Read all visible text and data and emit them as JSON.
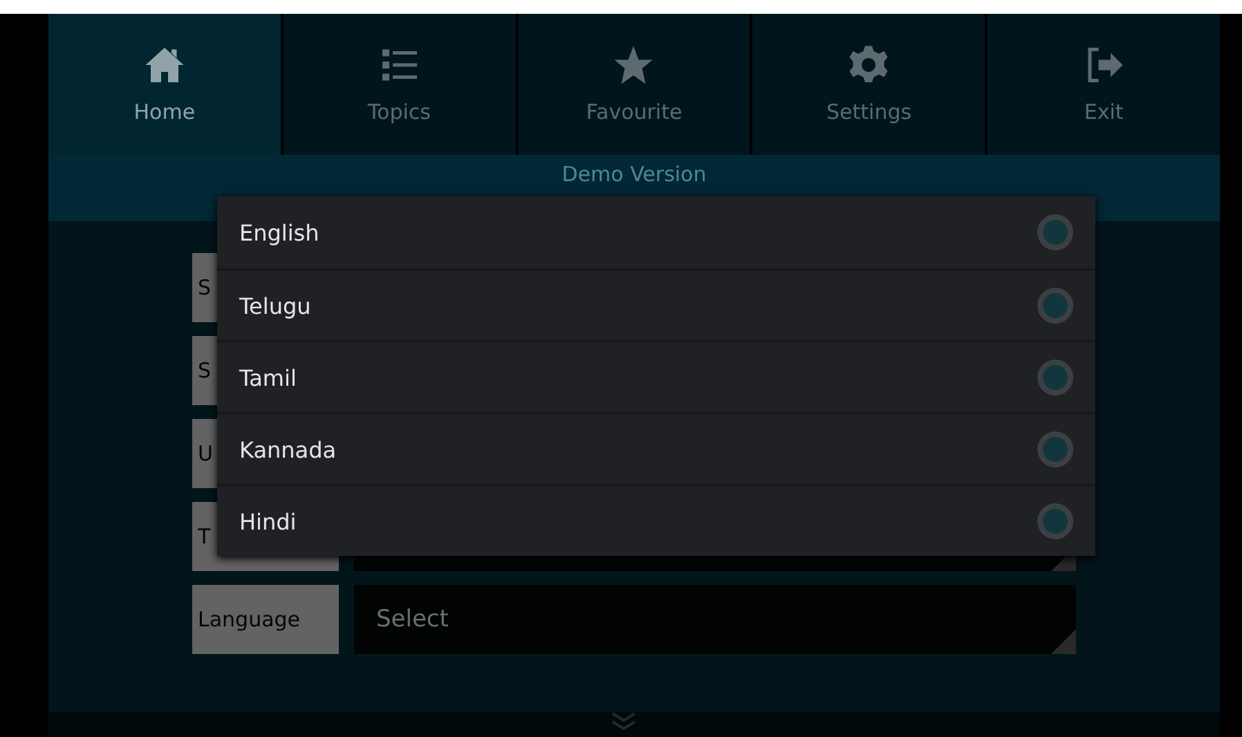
{
  "nav": [
    {
      "label": "Home",
      "selected": true
    },
    {
      "label": "Topics",
      "selected": false
    },
    {
      "label": "Favourite",
      "selected": false
    },
    {
      "label": "Settings",
      "selected": false
    },
    {
      "label": "Exit",
      "selected": false
    }
  ],
  "banner": "Demo Version",
  "form": [
    {
      "kind": "label",
      "label": "S"
    },
    {
      "kind": "label",
      "label": "S"
    },
    {
      "kind": "label",
      "label": "U"
    },
    {
      "kind": "field",
      "label": "T"
    },
    {
      "kind": "field",
      "label": "Language",
      "value": "Select"
    }
  ],
  "dialog": {
    "options": [
      {
        "label": "English",
        "selected": false
      },
      {
        "label": "Telugu",
        "selected": false
      },
      {
        "label": "Tamil",
        "selected": false
      },
      {
        "label": "Kannada",
        "selected": false
      },
      {
        "label": "Hindi",
        "selected": false
      }
    ]
  }
}
